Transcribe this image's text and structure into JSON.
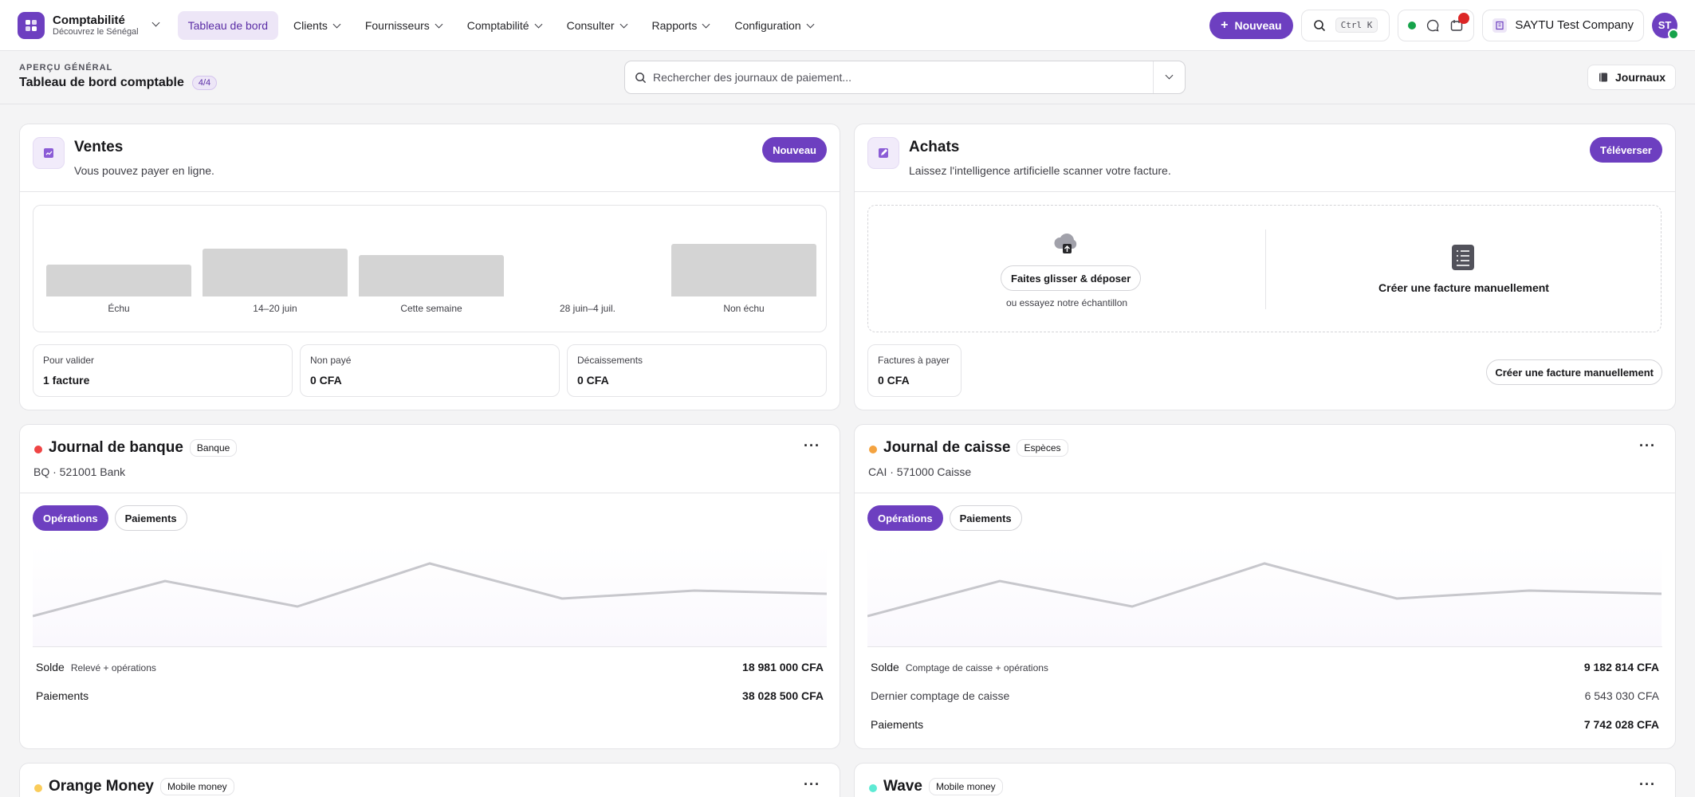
{
  "app": {
    "name": "Comptabilité",
    "subtitle": "Découvrez le Sénégal"
  },
  "nav": [
    {
      "label": "Tableau de bord",
      "active": true
    },
    {
      "label": "Clients"
    },
    {
      "label": "Fournisseurs"
    },
    {
      "label": "Comptabilité"
    },
    {
      "label": "Consulter"
    },
    {
      "label": "Rapports"
    },
    {
      "label": "Configuration"
    }
  ],
  "topbar": {
    "new_label": "Nouveau",
    "shortcut": "Ctrl K",
    "company": "SAYTU Test Company",
    "avatar": "ST",
    "notification_count": "1"
  },
  "header": {
    "overline": "APERÇU GÉNÉRAL",
    "title": "Tableau de bord comptable",
    "count": "4/4",
    "search_placeholder": "Rechercher des journaux de paiement...",
    "journals_label": "Journaux"
  },
  "sales": {
    "title": "Ventes",
    "subtitle": "Vous pouvez payer en ligne.",
    "button": "Nouveau",
    "chart_data": {
      "type": "bar",
      "categories": [
        "Échu",
        "14–20 juin",
        "Cette semaine",
        "28 juin–4 juil.",
        "Non échu"
      ],
      "values": [
        2,
        3,
        2.6,
        0,
        3.3
      ],
      "ylim": [
        0,
        3.5
      ]
    },
    "stats": [
      {
        "label": "Pour valider",
        "value": "1 facture"
      },
      {
        "label": "Non payé",
        "value": "0 CFA"
      },
      {
        "label": "Décaissements",
        "value": "0 CFA"
      }
    ]
  },
  "purchases": {
    "title": "Achats",
    "subtitle": "Laissez l'intelligence artificielle scanner votre facture.",
    "button": "Téléverser",
    "drag_label": "Faites glisser & déposer",
    "sample_hint": "ou essayez notre échantillon",
    "manual_label": "Créer une facture manuellement",
    "stat": {
      "label": "Factures à payer",
      "value": "0 CFA"
    },
    "manual_button": "Créer une facture manuellement"
  },
  "bank": {
    "title": "Journal de banque",
    "tag": "Banque",
    "subtitle": "BQ · 521001 Bank",
    "dot_color": "#ef4444",
    "tabs": [
      "Opérations",
      "Paiements"
    ],
    "balance_label": "Solde",
    "balance_note": "Relevé + opérations",
    "balance_value": "18 981 000 CFA",
    "payments_label": "Paiements",
    "payments_value": "38 028 500 CFA",
    "chart_data": {
      "type": "line",
      "x": [
        1,
        2,
        3,
        4,
        5,
        6,
        7
      ],
      "y": [
        1,
        3.2,
        1.6,
        4.3,
        2.1,
        2.6,
        2.4
      ]
    }
  },
  "cash": {
    "title": "Journal de caisse",
    "tag": "Espèces",
    "subtitle": "CAI · 571000 Caisse",
    "dot_color": "#f4a340",
    "tabs": [
      "Opérations",
      "Paiements"
    ],
    "balance_label": "Solde",
    "balance_note": "Comptage de caisse + opérations",
    "balance_value": "9 182 814 CFA",
    "last_count_label": "Dernier comptage de caisse",
    "last_count_value": "6 543 030 CFA",
    "payments_label": "Paiements",
    "payments_value": "7 742 028 CFA",
    "chart_data": {
      "type": "line",
      "x": [
        1,
        2,
        3,
        4,
        5,
        6,
        7
      ],
      "y": [
        1,
        3.2,
        1.6,
        4.3,
        2.1,
        2.6,
        2.4
      ]
    }
  },
  "orange": {
    "title": "Orange Money",
    "tag": "Mobile money",
    "dot_color": "#facc5a"
  },
  "wave": {
    "title": "Wave",
    "tag": "Mobile money",
    "dot_color": "#5eead4"
  }
}
